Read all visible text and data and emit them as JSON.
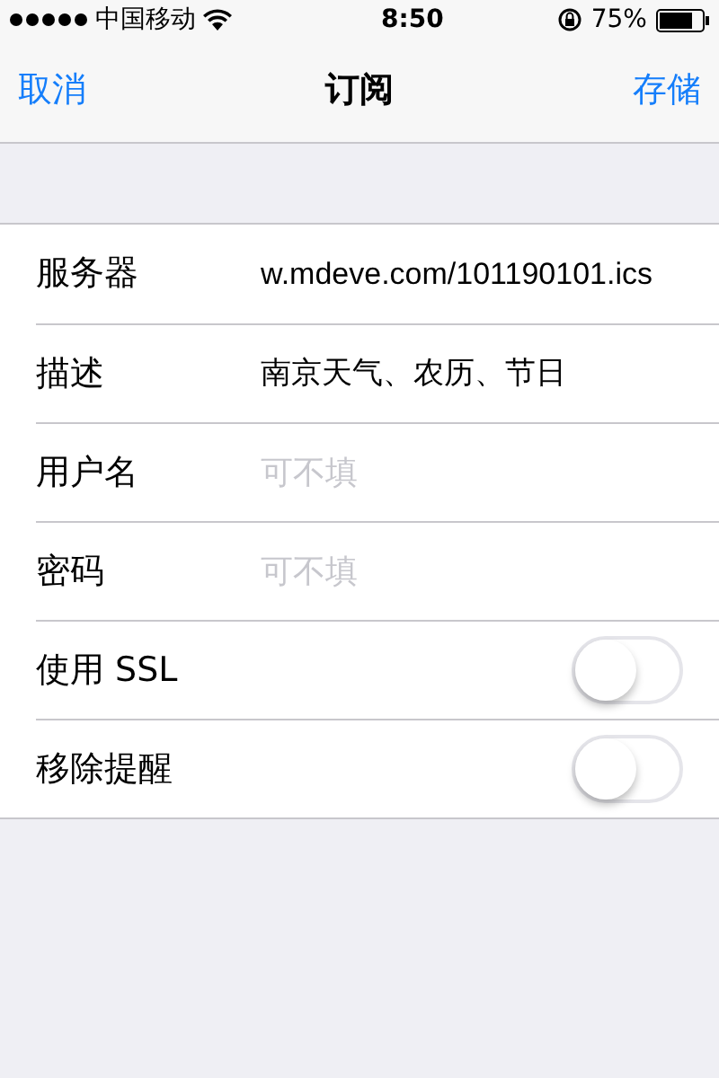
{
  "status_bar": {
    "carrier": "中国移动",
    "time": "8:50",
    "battery": "75%"
  },
  "nav": {
    "cancel": "取消",
    "title": "订阅",
    "save": "存储"
  },
  "rows": [
    {
      "kind": "field",
      "label": "服务器",
      "value": "w.mdeve.com/101190101.ics"
    },
    {
      "kind": "field",
      "label": "描述",
      "value": "南京天气、农历、节日"
    },
    {
      "kind": "field",
      "label": "用户名",
      "placeholder": "可不填"
    },
    {
      "kind": "field",
      "label": "密码",
      "placeholder": "可不填"
    },
    {
      "kind": "toggle",
      "label": "使用 SSL",
      "on": false
    },
    {
      "kind": "toggle",
      "label": "移除提醒",
      "on": false
    }
  ]
}
